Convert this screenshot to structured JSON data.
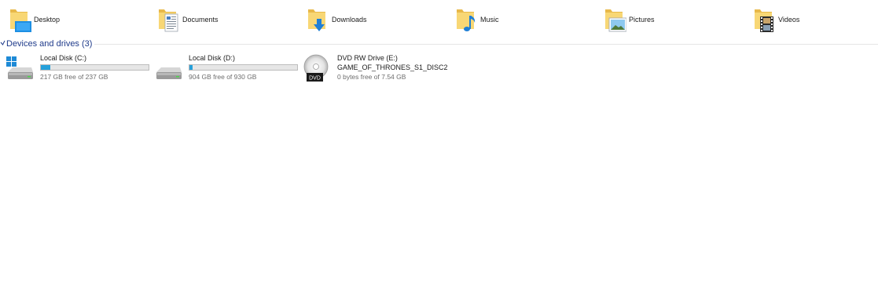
{
  "folders": [
    {
      "label": "Desktop",
      "icon": "desktop-folder-icon"
    },
    {
      "label": "Documents",
      "icon": "documents-folder-icon"
    },
    {
      "label": "Downloads",
      "icon": "downloads-folder-icon"
    },
    {
      "label": "Music",
      "icon": "music-folder-icon"
    },
    {
      "label": "Pictures",
      "icon": "pictures-folder-icon"
    },
    {
      "label": "Videos",
      "icon": "videos-folder-icon"
    }
  ],
  "devices_group": {
    "title": "Devices and drives (3)"
  },
  "drives": [
    {
      "name": "Local Disk (C:)",
      "free_text": "217 GB free of 237 GB",
      "used_fraction": 0.084,
      "icon": "windows-system-drive-icon"
    },
    {
      "name": "Local Disk (D:)",
      "free_text": "904 GB free of 930 GB",
      "used_fraction": 0.028,
      "icon": "hard-drive-icon"
    },
    {
      "name": "DVD RW Drive (E:)",
      "volume_label": "GAME_OF_THRONES_S1_DISC2",
      "free_text": "0 bytes free of 7.54 GB",
      "icon": "dvd-drive-icon",
      "icon_text": "DVD"
    }
  ],
  "colors": {
    "group_title": "#1e3a8a",
    "capacity_bar_fill": "#26a0da",
    "folder_yellow": "#f8d775"
  }
}
